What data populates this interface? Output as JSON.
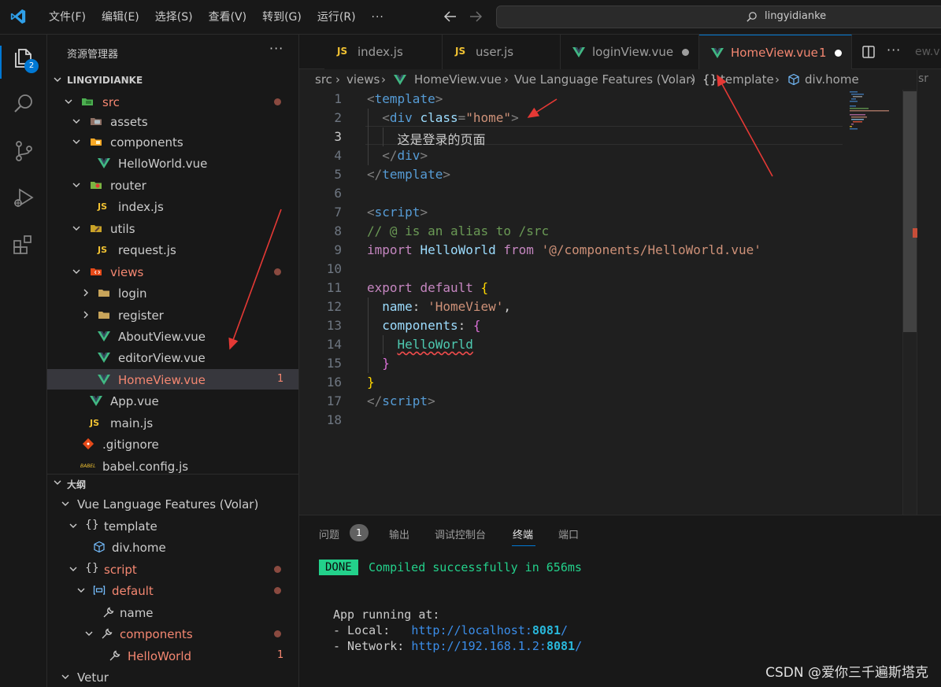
{
  "titlebar": {
    "menu": [
      "文件(F)",
      "编辑(E)",
      "选择(S)",
      "查看(V)",
      "转到(G)",
      "运行(R)"
    ],
    "more": "···",
    "search_text": "lingyidianke"
  },
  "activitybar": {
    "explorer_badge": "2"
  },
  "sidebar": {
    "title": "资源管理器",
    "more": "···",
    "workspace": "LINGYIDIANKE",
    "tree": [
      {
        "label": "src",
        "mod": true,
        "dot": true
      },
      {
        "label": "assets"
      },
      {
        "label": "components"
      },
      {
        "label": "HelloWorld.vue"
      },
      {
        "label": "router"
      },
      {
        "label": "index.js",
        "icon": "JS"
      },
      {
        "label": "utils"
      },
      {
        "label": "request.js",
        "icon": "JS"
      },
      {
        "label": "views",
        "mod": true,
        "dot": true
      },
      {
        "label": "login"
      },
      {
        "label": "register"
      },
      {
        "label": "AboutView.vue"
      },
      {
        "label": "editorView.vue"
      },
      {
        "label": "HomeView.vue",
        "mod": true,
        "count": "1"
      },
      {
        "label": "App.vue"
      },
      {
        "label": "main.js",
        "icon": "JS"
      },
      {
        "label": ".gitignore"
      },
      {
        "label": "babel.config.js",
        "icon": "BABEL"
      }
    ],
    "outline_title": "大纲",
    "outline": [
      {
        "label": "Vue Language Features (Volar)"
      },
      {
        "label": "template",
        "icon": "{}"
      },
      {
        "label": "div.home"
      },
      {
        "label": "script",
        "icon": "{}",
        "err": true
      },
      {
        "label": "default",
        "err": true
      },
      {
        "label": "name"
      },
      {
        "label": "components",
        "err": true
      },
      {
        "label": "HelloWorld",
        "err": true,
        "count": "1"
      },
      {
        "label": "Vetur"
      }
    ]
  },
  "tabs": [
    {
      "label": "index.js",
      "icon": "JS"
    },
    {
      "label": "user.js",
      "icon": "JS"
    },
    {
      "label": "loginView.vue"
    },
    {
      "label": "HomeView.vue",
      "suffix": "1"
    }
  ],
  "tab_more": "···",
  "tab_ghost": "ew.v",
  "breadcrumb": [
    "src",
    "views",
    "HomeView.vue",
    "Vue Language Features (Volar)",
    "template",
    "div.home"
  ],
  "breadcrumb_right": "sr",
  "template_icon": "{}",
  "code": {
    "line_numbers": [
      "1",
      "2",
      "3",
      "4",
      "5",
      "6",
      "7",
      "8",
      "9",
      "10",
      "11",
      "12",
      "13",
      "14",
      "15",
      "16",
      "17",
      "18"
    ],
    "l1_tag": "template",
    "l2_tag": "div",
    "l2_attr": "class",
    "l2_val": "\"home\"",
    "l3_text": "这是登录的页面",
    "l4_tag": "div",
    "l5_tag": "template",
    "l7_tag": "script",
    "l8_comment": "// @ is an alias to /src",
    "l9_import": "import",
    "l9_name": "HelloWorld",
    "l9_from": "from",
    "l9_path": "'@/components/HelloWorld.vue'",
    "l11_export": "export",
    "l11_default": "default",
    "l12_key": "name",
    "l12_val": "'HomeView'",
    "l13_key": "components",
    "l14_name": "HelloWorld",
    "l17_tag": "script"
  },
  "panel": {
    "tabs": [
      "问题",
      "输出",
      "调试控制台",
      "终端",
      "端口"
    ],
    "problems_count": "1",
    "terminal": {
      "done": "DONE",
      "compiled": "Compiled successfully in 656ms",
      "running": "App running at:",
      "local_label": "- Local:   ",
      "local_url": "http://localhost:",
      "local_port": "8081",
      "network_label": "- Network: ",
      "network_url": "http://192.168.1.2:",
      "network_port": "8081",
      "slash": "/"
    }
  },
  "watermark": "CSDN @爱你三千遍斯塔克",
  "colors": {
    "accent": "#0078d4",
    "modified": "#f48771",
    "success": "#23d18b",
    "vue": "#41b883"
  }
}
